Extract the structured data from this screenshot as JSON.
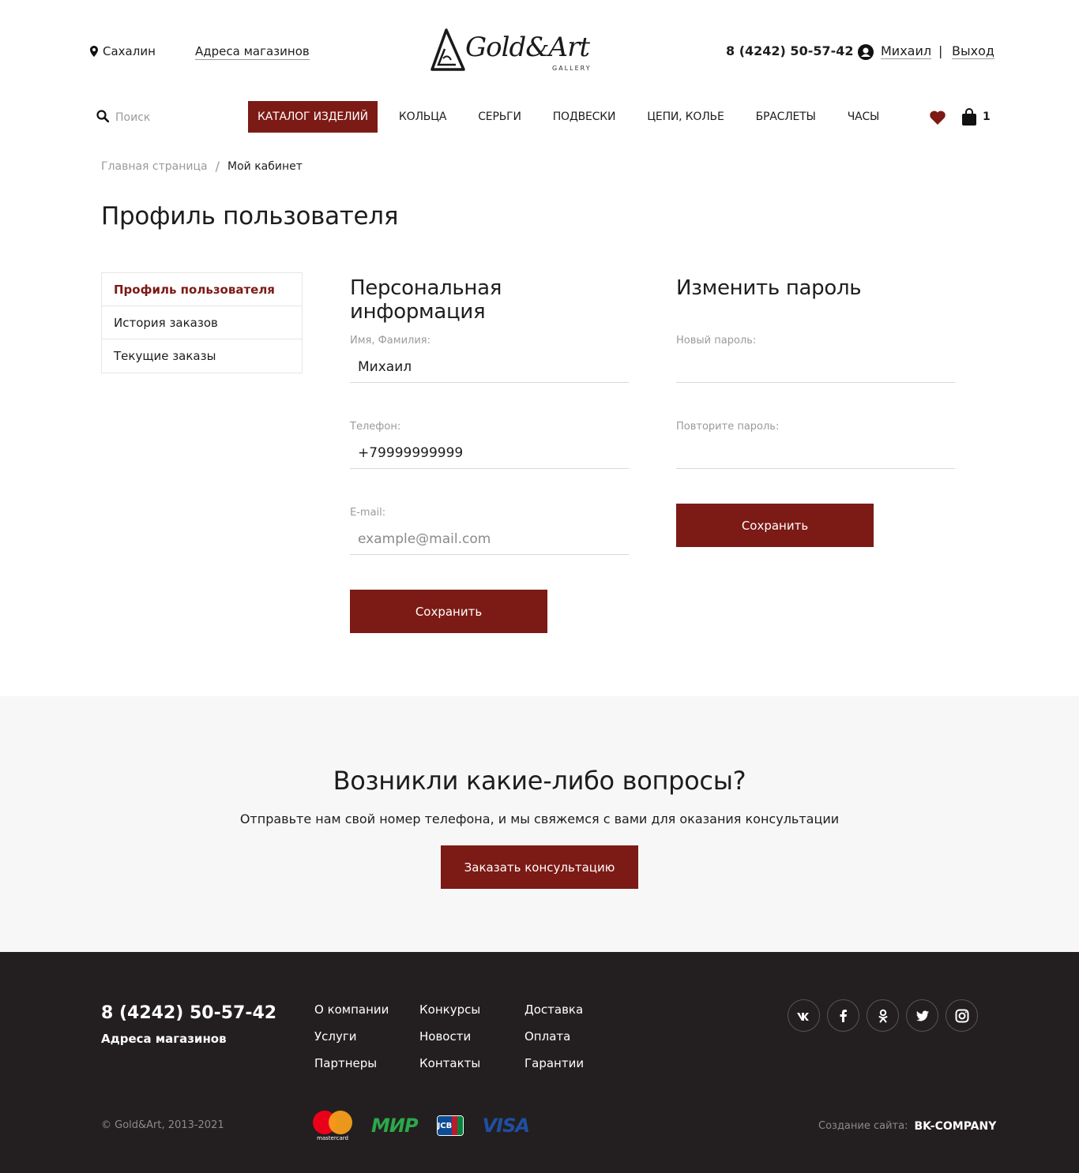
{
  "header": {
    "city": "Сахалин",
    "stores_link": "Адреса магазинов",
    "logo_text": "Gold&Art",
    "logo_sub": "GALLERY",
    "phone": "8 (4242) 50-57-42",
    "user_name": "Михаил",
    "separator": "|",
    "logout": "Выход"
  },
  "nav": {
    "search_placeholder": "Поиск",
    "items": [
      "КАТАЛОГ ИЗДЕЛИЙ",
      "КОЛЬЦА",
      "СЕРЬГИ",
      "ПОДВЕСКИ",
      "ЦЕПИ, КОЛЬЕ",
      "БРАСЛЕТЫ",
      "ЧАСЫ"
    ],
    "cart_count": "1"
  },
  "breadcrumb": {
    "home": "Главная страница",
    "slash": "/",
    "current": "Мой кабинет"
  },
  "page_title": "Профиль пользователя",
  "sidebar": {
    "items": [
      "Профиль пользователя",
      "История заказов",
      "Текущие заказы"
    ]
  },
  "personal": {
    "title": "Персональная информация",
    "name_label": "Имя, Фамилия:",
    "name_value": "Михаил",
    "phone_label": "Телефон:",
    "phone_value": "+79999999999",
    "email_label": "E-mail:",
    "email_placeholder": "example@mail.com",
    "save": "Сохранить"
  },
  "password": {
    "title": "Изменить пароль",
    "new_label": "Новый пароль:",
    "repeat_label": "Повторите пароль:",
    "save": "Сохранить"
  },
  "questions": {
    "title": "Возникли какие-либо вопросы?",
    "text": "Отправьте нам свой номер телефона, и мы свяжемся с вами для оказания консультации",
    "button": "Заказать консультацию"
  },
  "footer": {
    "phone": "8 (4242) 50-57-42",
    "stores": "Адреса магазинов",
    "col1": [
      "О компании",
      "Услуги",
      "Партнеры"
    ],
    "col2": [
      "Конкурсы",
      "Новости",
      "Контакты"
    ],
    "col3": [
      "Доставка",
      "Оплата",
      "Гарантии"
    ],
    "socials": [
      "vk-icon",
      "facebook-icon",
      "odnoklassniki-icon",
      "twitter-icon",
      "instagram-icon"
    ],
    "copyright": "© Gold&Art, 2013-2021",
    "payments": {
      "mastercard": "mastercard",
      "mir": "МИР",
      "jcb": "JCB",
      "visa": "VISA"
    },
    "made_label": "Создание сайта:",
    "made_by": "BK-COMPANY"
  },
  "colors": {
    "accent": "#7c1a15",
    "footer_bg": "#231f20",
    "band_bg": "#f7f7f7"
  }
}
